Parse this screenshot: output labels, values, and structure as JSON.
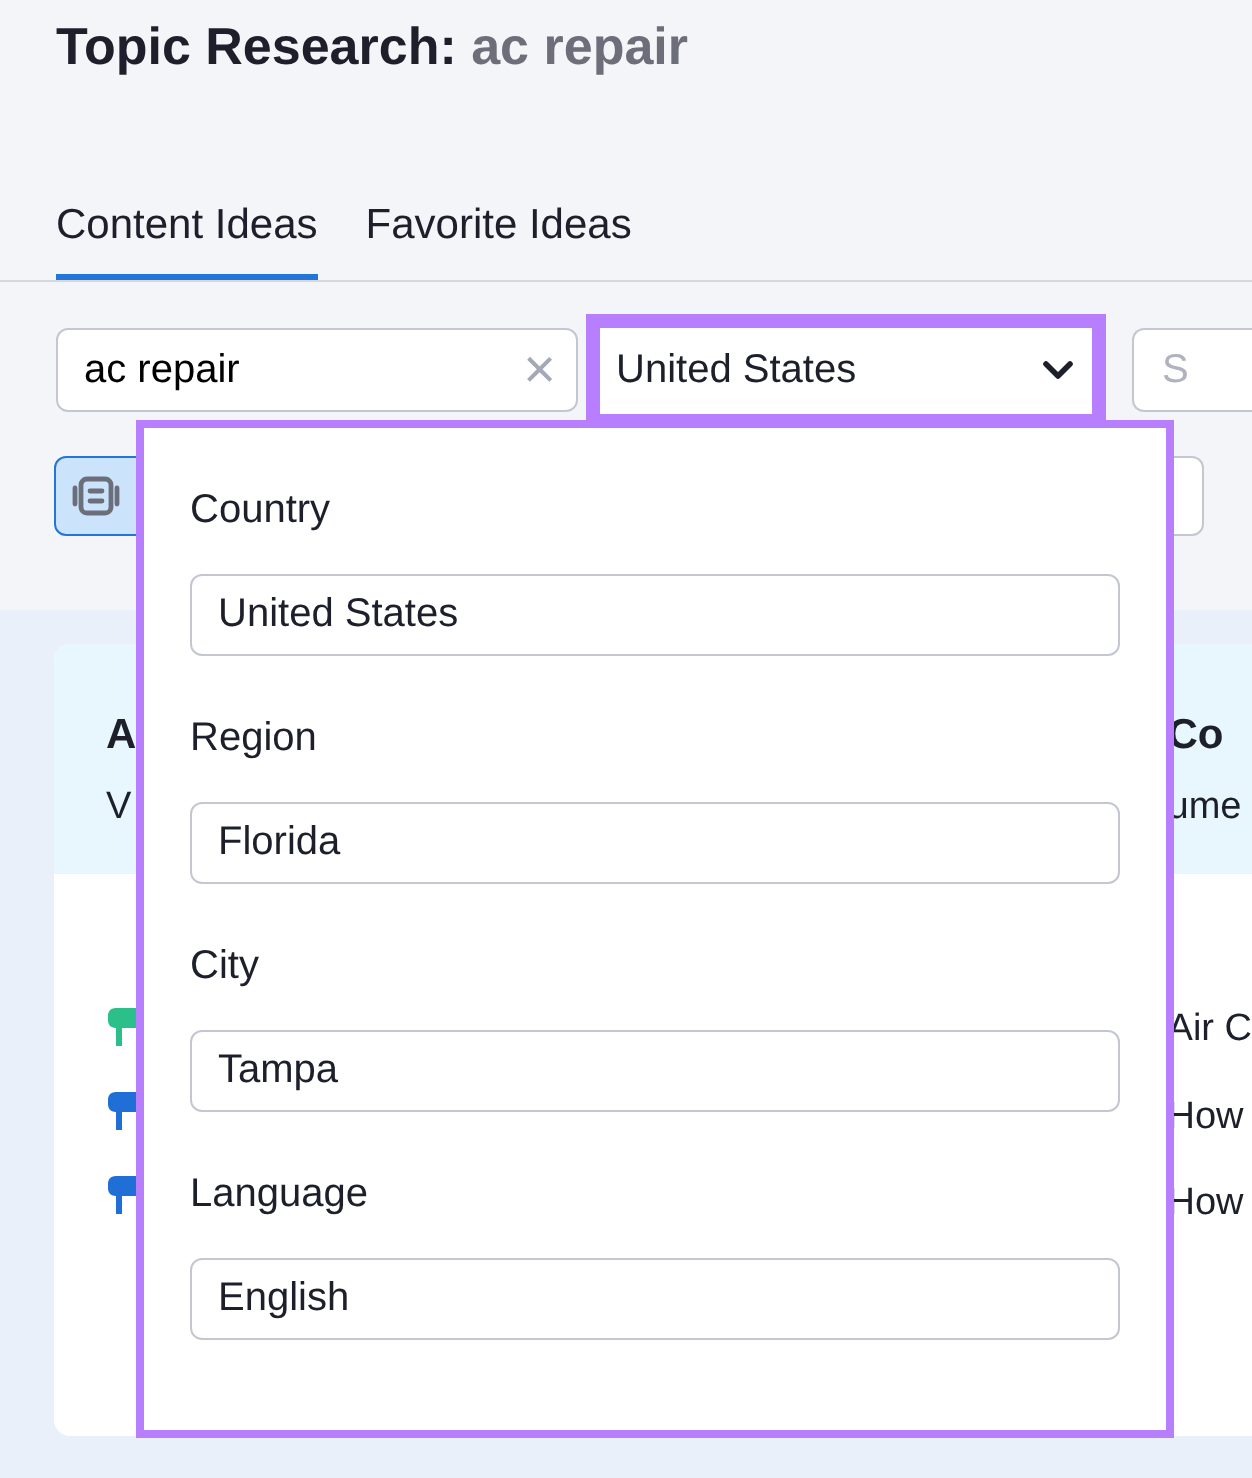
{
  "title": {
    "prefix": "Topic Research:",
    "query": "ac repair"
  },
  "tabs": [
    {
      "label": "Content Ideas",
      "selected": true
    },
    {
      "label": "Favorite Ideas",
      "selected": false
    }
  ],
  "filters": {
    "keyword": "ac repair",
    "clear": "×",
    "location": "United States",
    "extra_placeholder": "S"
  },
  "left_card": {
    "title": "A",
    "subtitle": "V",
    "ideas": [
      {
        "color": "#2bbf8a"
      },
      {
        "color": "#1f6fd6"
      },
      {
        "color": "#1f6fd6"
      }
    ]
  },
  "right_card": {
    "title": "Co",
    "subtitle": "ume",
    "ideas": [
      "Air C",
      "How",
      "How"
    ]
  },
  "dropdown": {
    "fields": [
      {
        "label": "Country",
        "value": "United States"
      },
      {
        "label": "Region",
        "value": "Florida"
      },
      {
        "label": "City",
        "value": "Tampa"
      },
      {
        "label": "Language",
        "value": "English"
      }
    ]
  }
}
